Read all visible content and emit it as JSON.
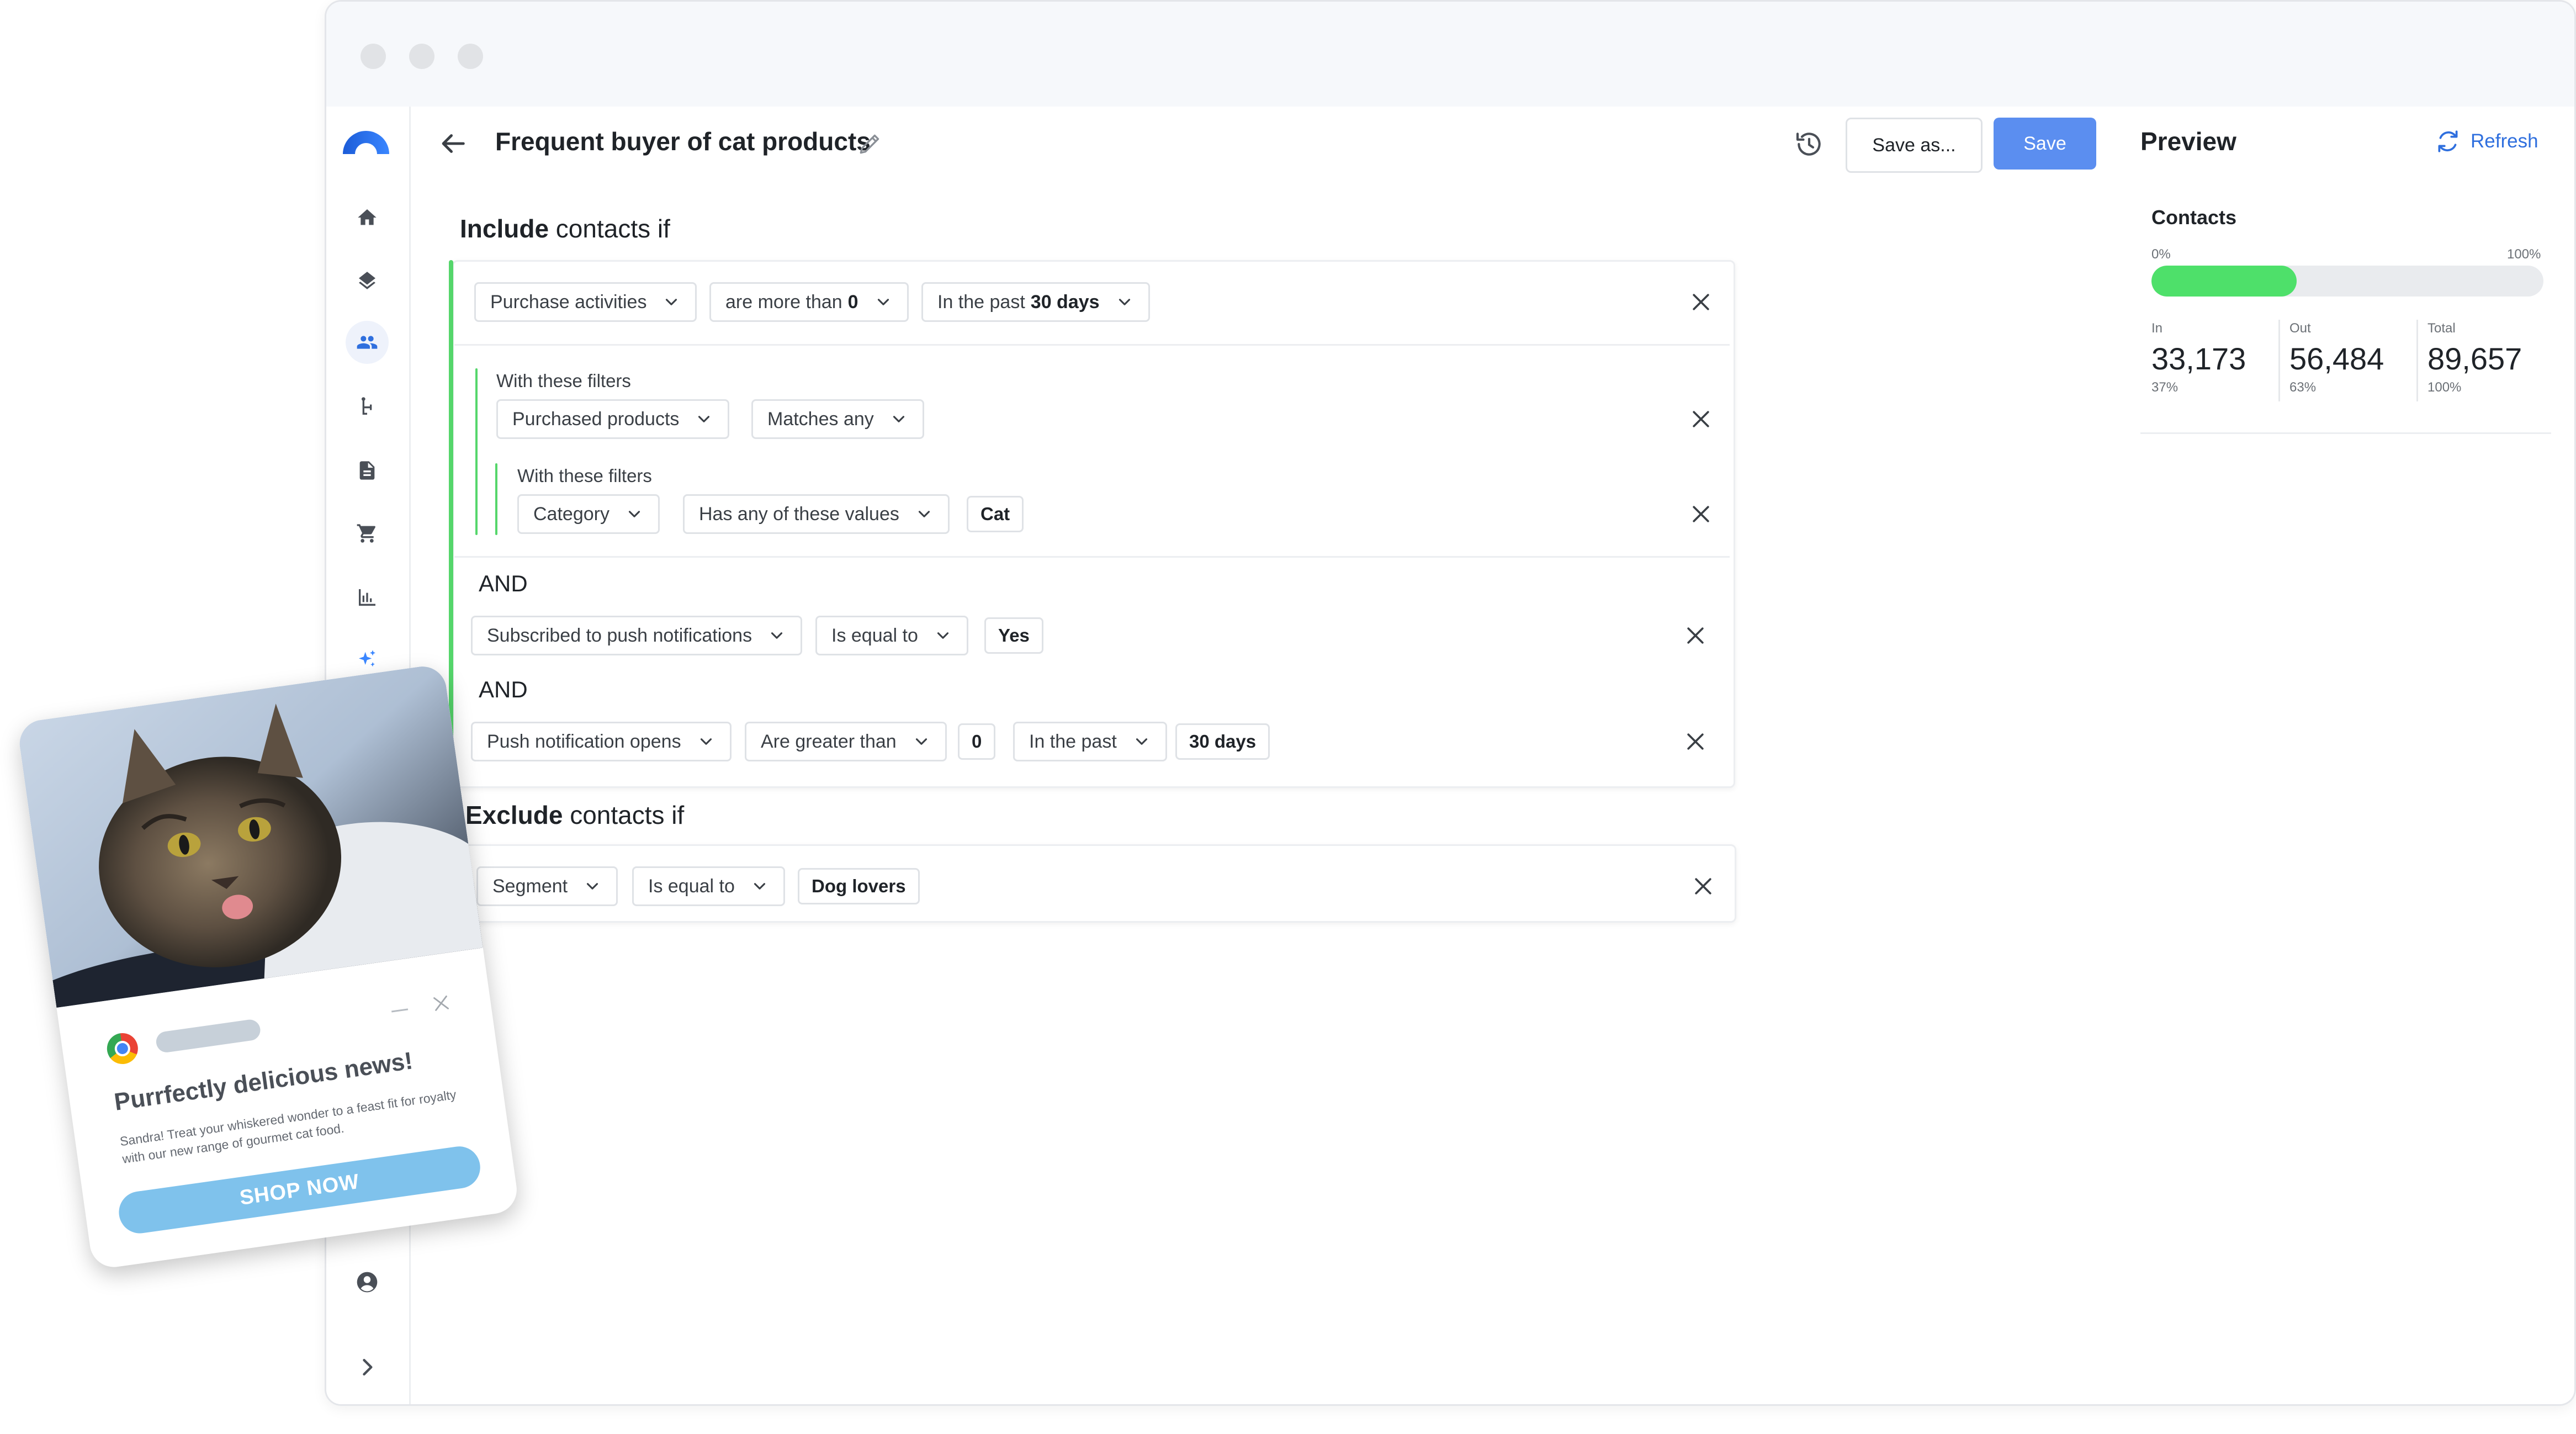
{
  "header": {
    "title": "Frequent buyer of cat products",
    "save_as_label": "Save as...",
    "save_label": "Save"
  },
  "sidebar": {
    "items": [
      {
        "name": "home"
      },
      {
        "name": "layers"
      },
      {
        "name": "contacts",
        "active": true
      },
      {
        "name": "journeys"
      },
      {
        "name": "documents"
      },
      {
        "name": "cart"
      },
      {
        "name": "analytics"
      },
      {
        "name": "ai-sparkle"
      }
    ],
    "bottom": [
      "account",
      "expand"
    ]
  },
  "include": {
    "heading_bold": "Include",
    "heading_rest": " contacts if",
    "rule1": {
      "field": "Purchase activities",
      "operator_prefix": "are more than",
      "operator_value": "0",
      "time_prefix": "In the past",
      "time_value": "30 days"
    },
    "filters1": {
      "label": "With these filters",
      "field": "Purchased products",
      "operator": "Matches any"
    },
    "filters2": {
      "label": "With these filters",
      "field": "Category",
      "operator": "Has any of these values",
      "value": "Cat"
    },
    "and1": "AND",
    "rule2": {
      "field": "Subscribed to push notifications",
      "operator": "Is equal to",
      "value": "Yes"
    },
    "and2": "AND",
    "rule3": {
      "field": "Push notification opens",
      "operator": "Are greater than",
      "count": "0",
      "time": "In the past",
      "time_value": "30 days"
    }
  },
  "exclude": {
    "heading_bold": "Exclude",
    "heading_rest": " contacts if",
    "rule1": {
      "field": "Segment",
      "operator": "Is equal to",
      "value": "Dog lovers"
    }
  },
  "preview": {
    "title": "Preview",
    "refresh_label": "Refresh",
    "contacts_label": "Contacts",
    "bar_min_label": "0%",
    "bar_max_label": "100%",
    "bar_fill_fraction": 0.37,
    "bar_color": "#4ee06a",
    "stats": {
      "in": {
        "label": "In",
        "value": "33,173",
        "pct": "37%"
      },
      "out": {
        "label": "Out",
        "value": "56,484",
        "pct": "63%"
      },
      "total": {
        "label": "Total",
        "value": "89,657",
        "pct": "100%"
      }
    }
  },
  "push_notification": {
    "title": "Purrfectly delicious news!",
    "body": "Sandra! Treat your whiskered wonder to a feast fit for royalty with our new range of gourmet cat food.",
    "button": "SHOP NOW"
  },
  "colors": {
    "accent_blue": "#5b8ef0",
    "include_green": "#55d66b",
    "exclude_red": "#f0441f",
    "link_blue": "#2f6fde"
  }
}
